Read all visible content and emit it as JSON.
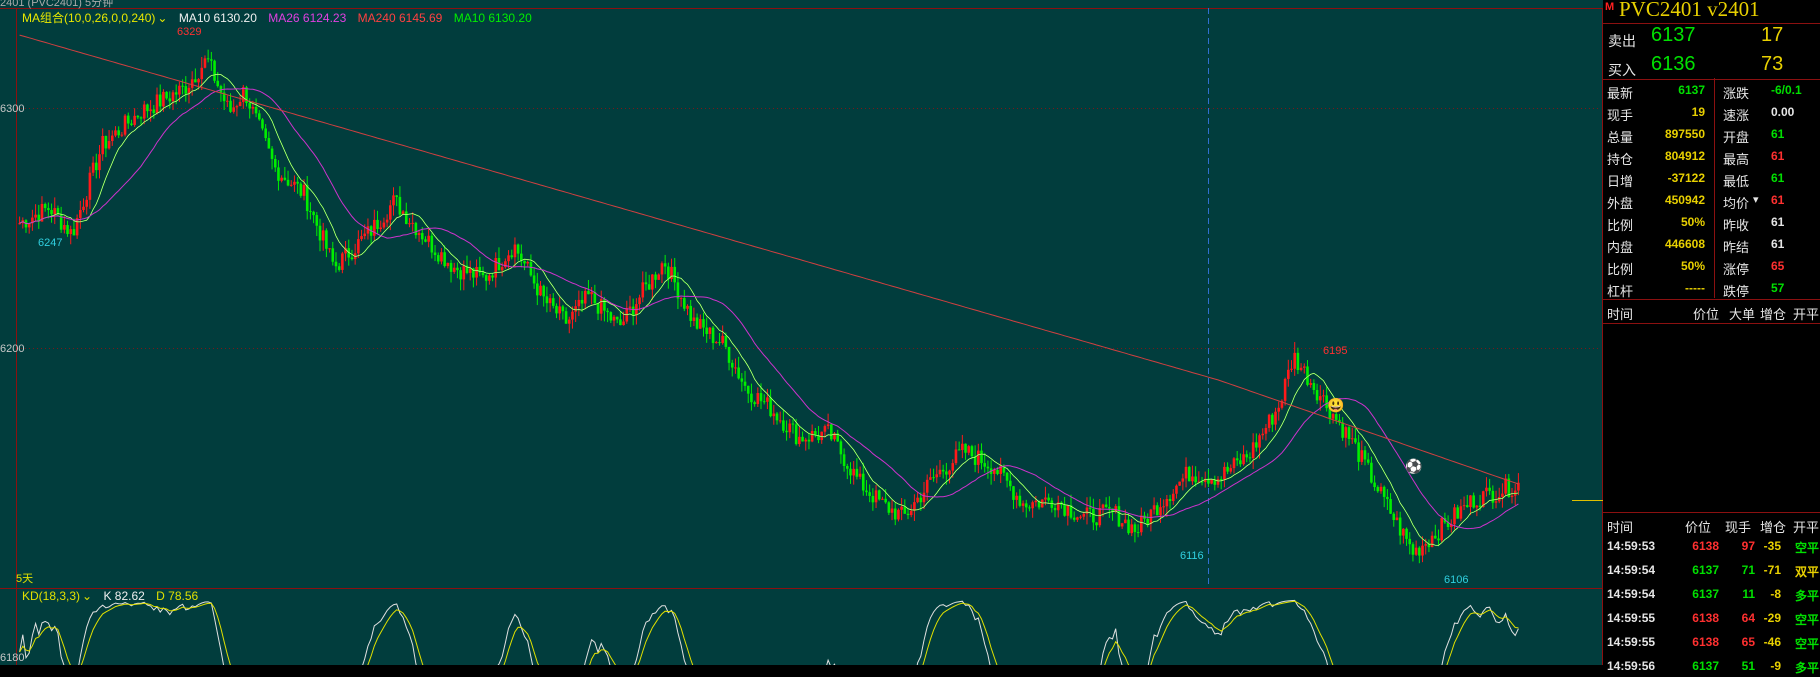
{
  "window": {
    "title_fragment": "2401  (PVC2401)  5分钟"
  },
  "colors": {
    "bg": "#013d3d",
    "up": "#ff1a1a",
    "down": "#00ee00",
    "ma10": "#f0f0f0",
    "ma26": "#cc33cc",
    "ma240": "#d04040",
    "ma10b": "#00ee00",
    "kd_k": "#e0e0e0",
    "kd_d": "#e0e000"
  },
  "chart": {
    "ma_legend": {
      "name": "MA组合(10,0,26,0,0,240)",
      "ma10": "MA10 6130.20",
      "ma26": "MA26 6124.23",
      "ma240": "MA240 6145.69",
      "ma10b": "MA10 6130.20"
    },
    "axis_labels": [
      "6300",
      "6200",
      "6180"
    ],
    "period": "5天",
    "indicator": {
      "name": "KD(18,3,3)",
      "k": "K 82.62",
      "d": "D 78.56"
    },
    "annotations": {
      "high": "6329",
      "low_left": "6247",
      "high_right": "6195",
      "low_mid": "6116",
      "low_right": "6106"
    },
    "icons": {
      "smile": "smile-icon",
      "ball": "soccer-ball-icon"
    }
  },
  "chart_data": {
    "type": "candlestick",
    "instrument": "PVC2401",
    "annotated_prices": {
      "max": 6329,
      "min": 6106,
      "left_low": 6247,
      "mid_low": 6116,
      "right_high": 6195
    },
    "last_ma": {
      "MA10": 6130.2,
      "MA26": 6124.23,
      "MA240": 6145.69
    },
    "last_kd": {
      "K": 82.62,
      "D": 78.56
    },
    "close_path": [
      {
        "x": 0.0,
        "p": 6255
      },
      {
        "x": 0.02,
        "p": 6262
      },
      {
        "x": 0.035,
        "p": 6250
      },
      {
        "x": 0.055,
        "p": 6290
      },
      {
        "x": 0.08,
        "p": 6305
      },
      {
        "x": 0.11,
        "p": 6316
      },
      {
        "x": 0.125,
        "p": 6329
      },
      {
        "x": 0.14,
        "p": 6305
      },
      {
        "x": 0.15,
        "p": 6315
      },
      {
        "x": 0.17,
        "p": 6280
      },
      {
        "x": 0.19,
        "p": 6268
      },
      {
        "x": 0.21,
        "p": 6235
      },
      {
        "x": 0.235,
        "p": 6252
      },
      {
        "x": 0.25,
        "p": 6265
      },
      {
        "x": 0.275,
        "p": 6245
      },
      {
        "x": 0.29,
        "p": 6235
      },
      {
        "x": 0.31,
        "p": 6230
      },
      {
        "x": 0.33,
        "p": 6245
      },
      {
        "x": 0.35,
        "p": 6220
      },
      {
        "x": 0.365,
        "p": 6210
      },
      {
        "x": 0.38,
        "p": 6222
      },
      {
        "x": 0.4,
        "p": 6208
      },
      {
        "x": 0.43,
        "p": 6238
      },
      {
        "x": 0.45,
        "p": 6210
      },
      {
        "x": 0.47,
        "p": 6200
      },
      {
        "x": 0.485,
        "p": 6180
      },
      {
        "x": 0.5,
        "p": 6172
      },
      {
        "x": 0.52,
        "p": 6158
      },
      {
        "x": 0.54,
        "p": 6160
      },
      {
        "x": 0.56,
        "p": 6138
      },
      {
        "x": 0.575,
        "p": 6128
      },
      {
        "x": 0.59,
        "p": 6122
      },
      {
        "x": 0.61,
        "p": 6140
      },
      {
        "x": 0.63,
        "p": 6152
      },
      {
        "x": 0.65,
        "p": 6145
      },
      {
        "x": 0.67,
        "p": 6128
      },
      {
        "x": 0.69,
        "p": 6130
      },
      {
        "x": 0.71,
        "p": 6122
      },
      {
        "x": 0.73,
        "p": 6124
      },
      {
        "x": 0.745,
        "p": 6116
      },
      {
        "x": 0.76,
        "p": 6128
      },
      {
        "x": 0.78,
        "p": 6142
      },
      {
        "x": 0.8,
        "p": 6140
      },
      {
        "x": 0.82,
        "p": 6150
      },
      {
        "x": 0.84,
        "p": 6172
      },
      {
        "x": 0.85,
        "p": 6195
      },
      {
        "x": 0.87,
        "p": 6175
      },
      {
        "x": 0.89,
        "p": 6155
      },
      {
        "x": 0.91,
        "p": 6130
      },
      {
        "x": 0.93,
        "p": 6106
      },
      {
        "x": 0.95,
        "p": 6118
      },
      {
        "x": 0.97,
        "p": 6130
      },
      {
        "x": 1.0,
        "p": 6137
      }
    ]
  },
  "side": {
    "symbol": "PVC2401  v2401",
    "marker": "M",
    "ask": {
      "label": "卖出",
      "price": "6137",
      "qty": "17"
    },
    "bid": {
      "label": "买入",
      "price": "6136",
      "qty": "73"
    },
    "quote_rows": [
      {
        "l1": "最新",
        "v1": "6137",
        "c1": "#00e000",
        "l2": "涨跌",
        "v2": "-6/0.1",
        "c2": "#00e000"
      },
      {
        "l1": "现手",
        "v1": "19",
        "c1": "#e8d000",
        "l2": "速涨",
        "v2": "0.00",
        "c2": "#e6e6e6"
      },
      {
        "l1": "总量",
        "v1": "897550",
        "c1": "#e8d000",
        "l2": "开盘",
        "v2": "61",
        "c2": "#00e000"
      },
      {
        "l1": "持仓",
        "v1": "804912",
        "c1": "#e8d000",
        "l2": "最高",
        "v2": "61",
        "c2": "#ff3030"
      },
      {
        "l1": "日增",
        "v1": "-37122",
        "c1": "#e8d000",
        "l2": "最低",
        "v2": "61",
        "c2": "#00e000"
      },
      {
        "l1": "外盘",
        "v1": "450942",
        "c1": "#e8d000",
        "l2": "均价",
        "v2": "61",
        "c2": "#ff3030"
      },
      {
        "l1": "比例",
        "v1": "50%",
        "c1": "#e8d000",
        "l2": "昨收",
        "v2": "61",
        "c2": "#e6e6e6"
      },
      {
        "l1": "内盘",
        "v1": "446608",
        "c1": "#e8d000",
        "l2": "昨结",
        "v2": "61",
        "c2": "#e6e6e6"
      },
      {
        "l1": "比例",
        "v1": "50%",
        "c1": "#e8d000",
        "l2": "涨停",
        "v2": "65",
        "c2": "#ff3030"
      },
      {
        "l1": "杠杆",
        "v1": "-----",
        "c1": "#e8d000",
        "l2": "跌停",
        "v2": "57",
        "c2": "#00e000"
      }
    ],
    "big_header": [
      "时间",
      "价位",
      "大单",
      "增仓",
      "开平"
    ],
    "tick_header": [
      "时间",
      "价位",
      "现手",
      "增仓",
      "开平"
    ],
    "ticks": [
      {
        "time": "14:59:53",
        "price": "6138",
        "vol": "97",
        "chg": "-35",
        "kind": "空平",
        "pc": "#ff3030",
        "vc": "#ff3030",
        "cc": "#e8d000",
        "kc": "#00e000"
      },
      {
        "time": "14:59:54",
        "price": "6137",
        "vol": "71",
        "chg": "-71",
        "kind": "双平",
        "pc": "#00e000",
        "vc": "#00e000",
        "cc": "#e8d000",
        "kc": "#e8d000"
      },
      {
        "time": "14:59:54",
        "price": "6137",
        "vol": "11",
        "chg": "-8",
        "kind": "多平",
        "pc": "#00e000",
        "vc": "#00e000",
        "cc": "#e8d000",
        "kc": "#00e000"
      },
      {
        "time": "14:59:55",
        "price": "6138",
        "vol": "64",
        "chg": "-29",
        "kind": "空平",
        "pc": "#ff3030",
        "vc": "#ff3030",
        "cc": "#e8d000",
        "kc": "#00e000"
      },
      {
        "time": "14:59:55",
        "price": "6138",
        "vol": "65",
        "chg": "-46",
        "kind": "空平",
        "pc": "#ff3030",
        "vc": "#ff3030",
        "cc": "#e8d000",
        "kc": "#00e000"
      },
      {
        "time": "14:59:56",
        "price": "6137",
        "vol": "51",
        "chg": "-9",
        "kind": "多平",
        "pc": "#00e000",
        "vc": "#00e000",
        "cc": "#e8d000",
        "kc": "#00e000"
      }
    ]
  }
}
